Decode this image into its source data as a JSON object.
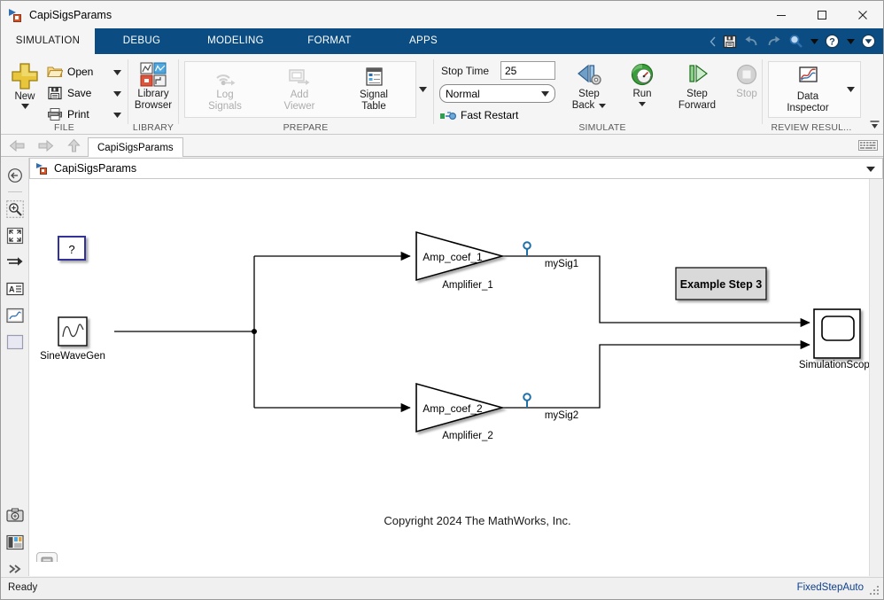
{
  "window": {
    "title": "CapiSigsParams",
    "minimize_label": "Minimize",
    "maximize_label": "Maximize",
    "close_label": "Close"
  },
  "tabs": [
    {
      "label": "SIMULATION",
      "active": true
    },
    {
      "label": "DEBUG",
      "active": false
    },
    {
      "label": "MODELING",
      "active": false
    },
    {
      "label": "FORMAT",
      "active": false
    },
    {
      "label": "APPS",
      "active": false
    }
  ],
  "quick_access": {
    "save_label": "Save",
    "undo_label": "Undo",
    "redo_label": "Redo",
    "search_label": "Search",
    "help_label": "Help",
    "collapse_label": "Show/Hide"
  },
  "ribbon": {
    "groups": [
      {
        "name": "FILE",
        "label": "FILE"
      },
      {
        "name": "LIBRARY",
        "label": "LIBRARY"
      },
      {
        "name": "PREPARE",
        "label": "PREPARE"
      },
      {
        "name": "SIMULATE",
        "label": "SIMULATE"
      },
      {
        "name": "REVIEW",
        "label": "REVIEW RESUL..."
      }
    ],
    "file": {
      "new_label": "New",
      "open_label": "Open",
      "save_label": "Save",
      "print_label": "Print"
    },
    "library": {
      "library_browser_line1": "Library",
      "library_browser_line2": "Browser"
    },
    "prepare": {
      "log_signals_line1": "Log",
      "log_signals_line2": "Signals",
      "add_viewer_line1": "Add",
      "add_viewer_line2": "Viewer",
      "signal_table_line1": "Signal",
      "signal_table_line2": "Table"
    },
    "simulate": {
      "stop_time_label": "Stop Time",
      "stop_time_value": "25",
      "sim_mode_value": "Normal",
      "fast_restart_label": "Fast Restart",
      "step_back_line1": "Step",
      "step_back_line2": "Back",
      "run_label": "Run",
      "step_forward_line1": "Step",
      "step_forward_line2": "Forward",
      "stop_label": "Stop"
    },
    "review": {
      "data_inspector_line1": "Data",
      "data_inspector_line2": "Inspector"
    }
  },
  "model_bar": {
    "back_label": "Back",
    "forward_label": "Forward",
    "up_label": "Up",
    "tab_label": "CapiSigsParams"
  },
  "breadcrumb": {
    "path": "CapiSigsParams"
  },
  "palette": {
    "items": [
      {
        "name": "hide-explorer-bar-icon",
        "label": "Hide Explorer Bar"
      },
      {
        "name": "zoom-in-icon",
        "label": "Zoom In"
      },
      {
        "name": "fit-to-view-icon",
        "label": "Fit to View"
      },
      {
        "name": "signal-lines-icon",
        "label": "Signal Lines"
      },
      {
        "name": "annotation-icon",
        "label": "Annotation"
      },
      {
        "name": "image-icon",
        "label": "Image"
      },
      {
        "name": "area-icon",
        "label": "Area"
      },
      {
        "name": "camera-icon",
        "label": "Screenshot"
      },
      {
        "name": "layout-icon",
        "label": "Layout"
      },
      {
        "name": "more-icon",
        "label": "More"
      }
    ]
  },
  "canvas": {
    "blocks": [
      {
        "name": "unknown-block",
        "label": "?",
        "caption": ""
      },
      {
        "name": "sine-wave-gen-block",
        "label": "",
        "caption": "SineWaveGen"
      },
      {
        "name": "amplifier-1-block",
        "label": "Amp_coef_1",
        "caption": "Amplifier_1"
      },
      {
        "name": "amplifier-2-block",
        "label": "Amp_coef_2",
        "caption": "Amplifier_2"
      },
      {
        "name": "simulation-scope-block",
        "label": "",
        "caption": "SimulationScope"
      }
    ],
    "signals": [
      {
        "name": "signal-mysig1",
        "label": "mySig1"
      },
      {
        "name": "signal-mysig2",
        "label": "mySig2"
      }
    ],
    "annotations": [
      {
        "name": "example-step-3-annotation",
        "text": "Example Step 3"
      },
      {
        "name": "copyright-annotation",
        "text": "Copyright 2024 The MathWorks, Inc."
      }
    ]
  },
  "status": {
    "message": "Ready",
    "solver": "FixedStepAuto"
  },
  "colors": {
    "ribbon_tab_bar": "#0b4d82",
    "accent_blue": "#2f6fb0",
    "signal_marker": "#1f6fa8",
    "solver_text": "#0d3f8f",
    "annotation_fill": "#d9d9d9",
    "canvas_bg": "#ffffff"
  }
}
